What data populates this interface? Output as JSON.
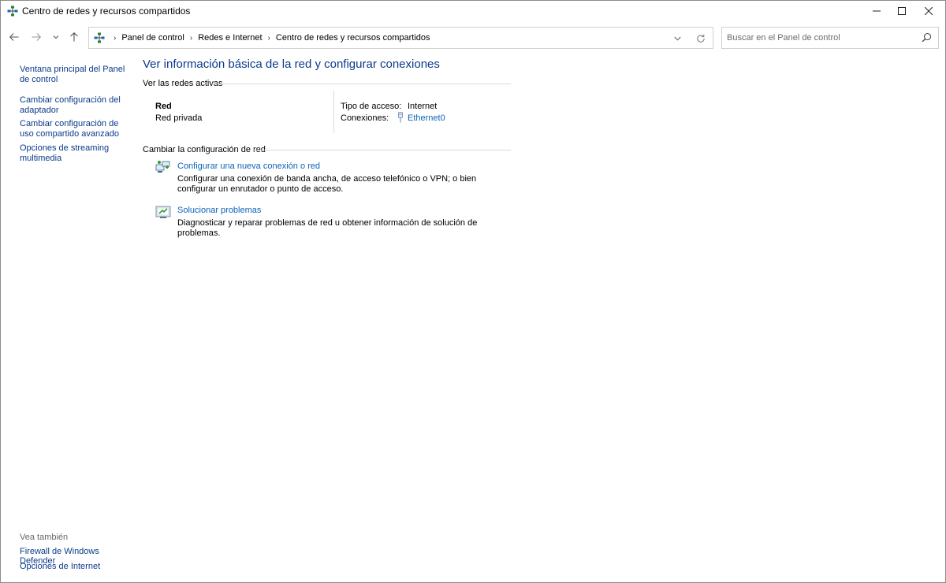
{
  "window": {
    "title": "Centro de redes y recursos compartidos",
    "icon": "network-center-icon"
  },
  "address": {
    "breadcrumbs": [
      "Panel de control",
      "Redes e Internet",
      "Centro de redes y recursos compartidos"
    ]
  },
  "search": {
    "placeholder": "Buscar en el Panel de control"
  },
  "sidebar": {
    "links": [
      "Ventana principal del Panel de control",
      "Cambiar configuración del adaptador",
      "Cambiar configuración de uso compartido avanzado",
      "Opciones de streaming multimedia"
    ],
    "see_also_label": "Vea también",
    "see_also_links": [
      "Firewall de Windows Defender",
      "Opciones de Internet"
    ]
  },
  "main": {
    "heading": "Ver información básica de la red y configurar conexiones",
    "active_networks_title": "Ver las redes activas",
    "network": {
      "name": "Red",
      "type": "Red privada",
      "access_label": "Tipo de acceso:",
      "access_value": "Internet",
      "connections_label": "Conexiones:",
      "connection_link": "Ethernet0"
    },
    "change_settings_title": "Cambiar la configuración de red",
    "tasks": [
      {
        "link": "Configurar una nueva conexión o red",
        "description": "Configurar una conexión de banda ancha, de acceso telefónico o VPN; o bien configurar un enrutador o punto de acceso."
      },
      {
        "link": "Solucionar problemas",
        "description": "Diagnosticar y reparar problemas de red u obtener información de solución de problemas."
      }
    ]
  },
  "colors": {
    "link": "#0b63b8",
    "heading": "#0b3a8a",
    "divider": "#d9d9d9"
  }
}
